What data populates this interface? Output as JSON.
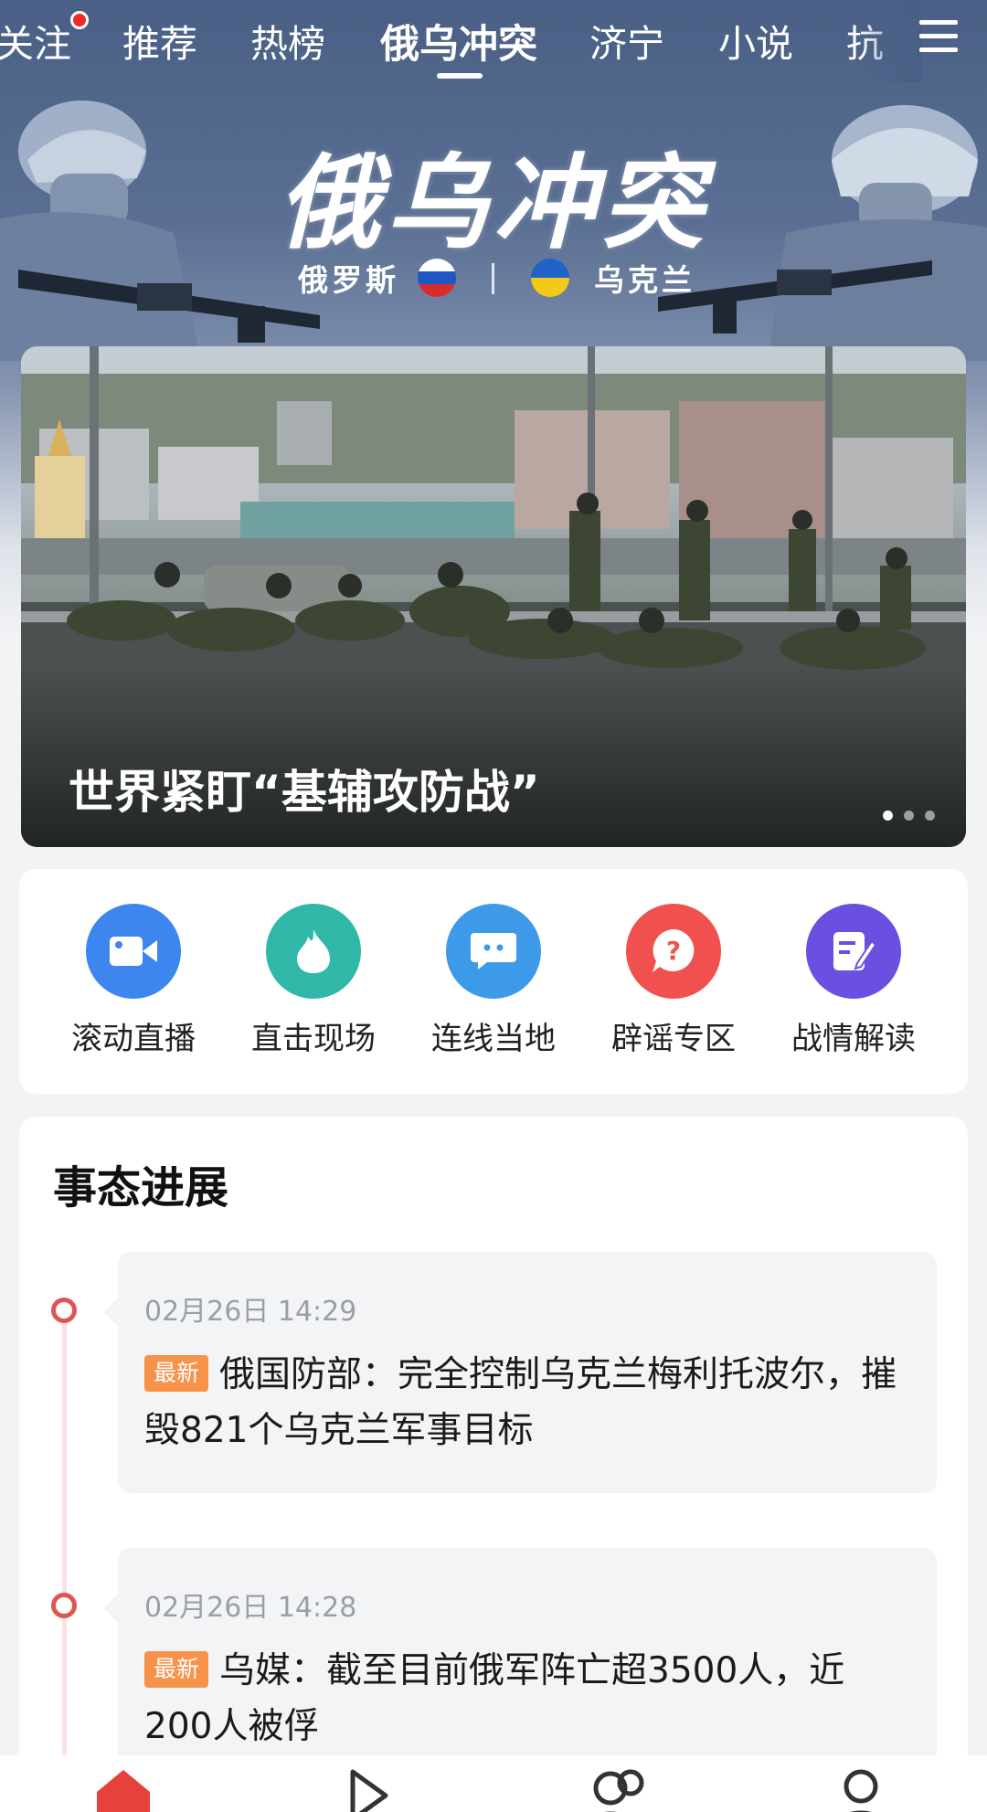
{
  "top_tabs": {
    "items": [
      {
        "label": "关注",
        "has_dot": true
      },
      {
        "label": "推荐"
      },
      {
        "label": "热榜"
      },
      {
        "label": "俄乌冲突",
        "active": true
      },
      {
        "label": "济宁"
      },
      {
        "label": "小说"
      },
      {
        "label": "抗"
      }
    ],
    "menu_icon": "hamburger-menu-icon"
  },
  "banner": {
    "title": "俄乌冲突",
    "left_country": "俄罗斯",
    "right_country": "乌克兰",
    "colors": {
      "background": "#4a5f85"
    }
  },
  "hero": {
    "caption": "世界紧盯“基辅攻防战”",
    "dots_total": 3,
    "dots_active": 1
  },
  "quick_entries": [
    {
      "label": "滚动直播",
      "icon": "video-camera-icon",
      "color": "#3d86ef"
    },
    {
      "label": "直击现场",
      "icon": "flame-icon",
      "color": "#2fb8a8"
    },
    {
      "label": "连线当地",
      "icon": "chat-bubble-icon",
      "color": "#3d9ae8"
    },
    {
      "label": "辟谣专区",
      "icon": "question-bubble-icon",
      "color": "#f0514f"
    },
    {
      "label": "战情解读",
      "icon": "edit-note-icon",
      "color": "#6a4fe0"
    }
  ],
  "progress": {
    "title": "事态进展",
    "items": [
      {
        "time": "02月26日 14:29",
        "badge": "最新",
        "text": "俄国防部：完全控制乌克兰梅利托波尔，摧毁821个乌克兰军事目标"
      },
      {
        "time": "02月26日 14:28",
        "badge": "最新",
        "text": "乌媒：截至目前俄军阵亡超3500人，近200人被俘"
      }
    ]
  },
  "bottom_nav": {
    "items": [
      {
        "icon": "home-icon",
        "active": true
      },
      {
        "icon": "play-video-icon"
      },
      {
        "icon": "community-icon"
      },
      {
        "icon": "profile-icon"
      }
    ],
    "accent": "#e8403a"
  }
}
